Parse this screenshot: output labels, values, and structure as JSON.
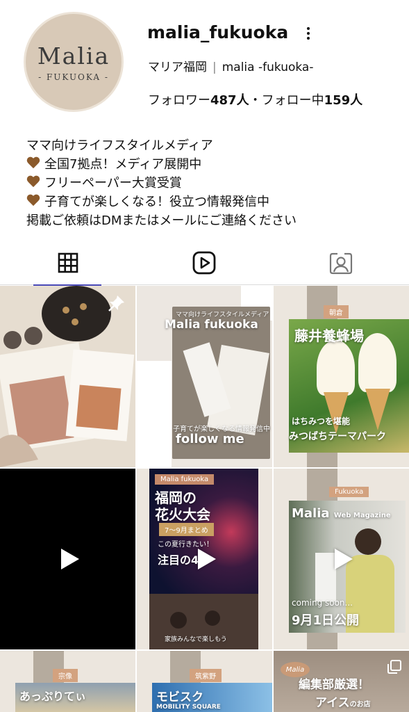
{
  "profile": {
    "avatar_brand": "Malia",
    "avatar_city": "- FUKUOKA -",
    "username": "malia_fukuoka",
    "fullname": "マリア福岡",
    "fullname_sep": "|",
    "subtitle": "malia -fukuoka-",
    "followers_label": "フォロワー",
    "followers_count": "487人",
    "dot": "・",
    "following_label": "フォロー中",
    "following_count": "159人"
  },
  "bio": {
    "line1": "ママ向けライフスタイルメディア",
    "line2": "全国7拠点！メディア展開中",
    "line3": "フリーペーパー大賞受賞",
    "line4": "子育てが楽しくなる！役立つ情報発信中",
    "line5": "掲載ご依頼はDMまたはメールにご連絡ください"
  },
  "tabs": [
    {
      "name": "posts",
      "icon": "grid-icon",
      "active": true
    },
    {
      "name": "reels",
      "icon": "reels-icon",
      "active": false
    },
    {
      "name": "tagged",
      "icon": "tagged-person-icon",
      "active": false
    }
  ],
  "posts": {
    "p2_top": "ママ向けライフスタイルメディア",
    "p2_title": "Malia fukuoka",
    "p2_sub": "子育てが楽しくなる情報発信中",
    "p2_cta": "follow me",
    "p3_tag": "朝倉",
    "p3_title": "藤井養蜂場",
    "p3_sub": "はちみつを堪能",
    "p3_sub2": "みつばちテーマパーク",
    "p5_tag": "Malia fukuoka",
    "p5_title1": "福岡の",
    "p5_title2": "花火大会",
    "p5_range": "7〜9月まとめ",
    "p5_note": "この夏行きたい！",
    "p5_focus": "注目の4",
    "p5_bottom": "家族みんなで楽しもう",
    "p6_tag": "Fukuoka",
    "p6_title": "Malia",
    "p6_title_sub": "Web Magazine",
    "p6_soon": "coming soon...",
    "p6_date": "9月1日公開",
    "p7_tag": "宗像",
    "p7_title": "あっぷりてぃ",
    "p8_tag": "筑紫野",
    "p8_title": "モビスク",
    "p8_sub": "MOBILITY SQUARE",
    "p9_badge": "Malia",
    "p9_title1": "編集部厳選！",
    "p9_title2": "アイス",
    "p9_title3": "のお店"
  }
}
